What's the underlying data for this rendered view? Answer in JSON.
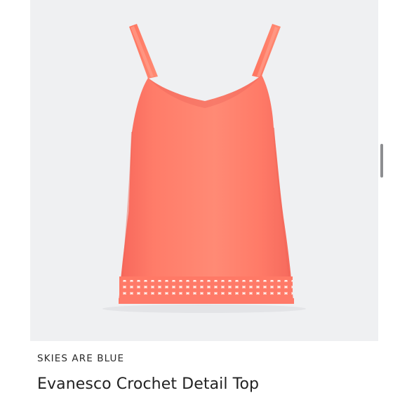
{
  "product": {
    "brand": "SKIES ARE BLUE",
    "title": "Evanesco Crochet Detail Top",
    "image": {
      "subject": "tank-top",
      "color": "#ff7f6e",
      "background": "#eff0f2"
    }
  },
  "scrollbar": {
    "visible": true
  }
}
